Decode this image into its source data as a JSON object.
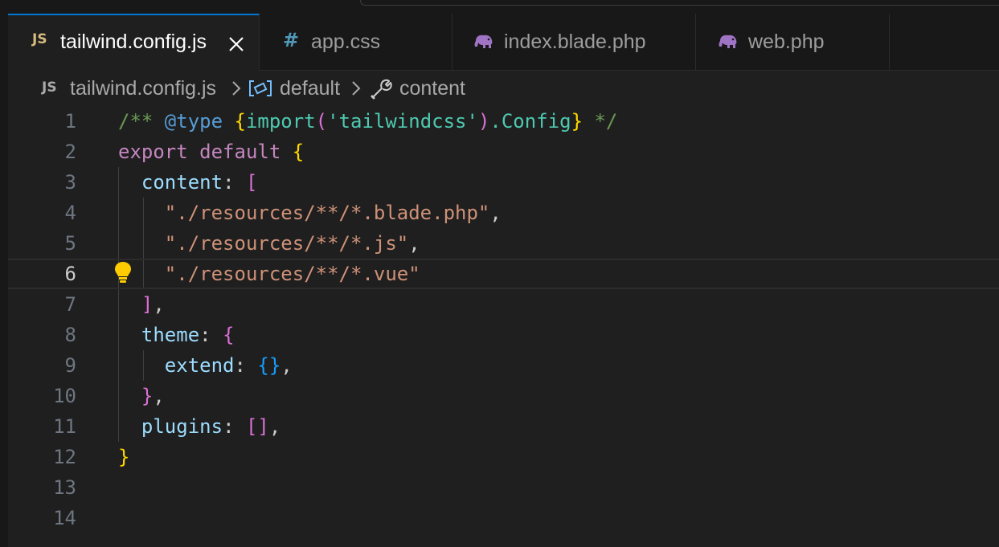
{
  "tabs": [
    {
      "icon": "JS",
      "icon_name": "javascript-icon",
      "label": "tailwind.config.js",
      "active": true
    },
    {
      "icon": "#",
      "icon_name": "css-hash-icon",
      "label": "app.css",
      "active": false
    },
    {
      "icon": "php",
      "icon_name": "php-elephant-icon",
      "label": "index.blade.php",
      "active": false
    },
    {
      "icon": "php",
      "icon_name": "php-elephant-icon",
      "label": "web.php",
      "active": false
    }
  ],
  "breadcrumb": {
    "file_icon": "JS",
    "file": "tailwind.config.js",
    "symbol1": "default",
    "symbol1_icon": "variable-symbol-icon",
    "symbol2": "content",
    "symbol2_icon": "wrench-property-icon"
  },
  "editor": {
    "current_line": 6,
    "lines": [
      {
        "n": "1",
        "tokens": [
          {
            "t": "/** ",
            "c": "tok-comment"
          },
          {
            "t": "@type",
            "c": "tok-doctag"
          },
          {
            "t": " ",
            "c": "tok-comment"
          },
          {
            "t": "{",
            "c": "b1"
          },
          {
            "t": "import",
            "c": "tok-type"
          },
          {
            "t": "(",
            "c": "b2"
          },
          {
            "t": "'tailwindcss'",
            "c": "tok-type"
          },
          {
            "t": ")",
            "c": "b2"
          },
          {
            "t": ".Config",
            "c": "tok-type"
          },
          {
            "t": "}",
            "c": "b1"
          },
          {
            "t": " */",
            "c": "tok-comment"
          }
        ]
      },
      {
        "n": "2",
        "tokens": [
          {
            "t": "export",
            "c": "tok-keyword"
          },
          {
            "t": " ",
            "c": "tok-punct"
          },
          {
            "t": "default",
            "c": "tok-keyword"
          },
          {
            "t": " ",
            "c": "tok-punct"
          },
          {
            "t": "{",
            "c": "b1"
          }
        ]
      },
      {
        "n": "3",
        "tokens": [
          {
            "t": "  ",
            "c": "tok-punct"
          },
          {
            "t": "content",
            "c": "tok-prop"
          },
          {
            "t": ": ",
            "c": "tok-punct"
          },
          {
            "t": "[",
            "c": "b2"
          }
        ]
      },
      {
        "n": "4",
        "tokens": [
          {
            "t": "    ",
            "c": "tok-punct"
          },
          {
            "t": "\"./resources/**/*.blade.php\"",
            "c": "tok-string"
          },
          {
            "t": ",",
            "c": "tok-punct"
          }
        ]
      },
      {
        "n": "5",
        "tokens": [
          {
            "t": "    ",
            "c": "tok-punct"
          },
          {
            "t": "\"./resources/**/*.js\"",
            "c": "tok-string"
          },
          {
            "t": ",",
            "c": "tok-punct"
          }
        ]
      },
      {
        "n": "6",
        "tokens": [
          {
            "t": "    ",
            "c": "tok-punct"
          },
          {
            "t": "\"./resources/**/*.vue\"",
            "c": "tok-string"
          }
        ]
      },
      {
        "n": "7",
        "tokens": [
          {
            "t": "  ",
            "c": "tok-punct"
          },
          {
            "t": "]",
            "c": "b2"
          },
          {
            "t": ",",
            "c": "tok-punct"
          }
        ]
      },
      {
        "n": "8",
        "tokens": [
          {
            "t": "  ",
            "c": "tok-punct"
          },
          {
            "t": "theme",
            "c": "tok-prop"
          },
          {
            "t": ": ",
            "c": "tok-punct"
          },
          {
            "t": "{",
            "c": "b2"
          }
        ]
      },
      {
        "n": "9",
        "tokens": [
          {
            "t": "    ",
            "c": "tok-punct"
          },
          {
            "t": "extend",
            "c": "tok-prop"
          },
          {
            "t": ": ",
            "c": "tok-punct"
          },
          {
            "t": "{}",
            "c": "b3"
          },
          {
            "t": ",",
            "c": "tok-punct"
          }
        ]
      },
      {
        "n": "10",
        "tokens": [
          {
            "t": "  ",
            "c": "tok-punct"
          },
          {
            "t": "}",
            "c": "b2"
          },
          {
            "t": ",",
            "c": "tok-punct"
          }
        ]
      },
      {
        "n": "11",
        "tokens": [
          {
            "t": "  ",
            "c": "tok-punct"
          },
          {
            "t": "plugins",
            "c": "tok-prop"
          },
          {
            "t": ": ",
            "c": "tok-punct"
          },
          {
            "t": "[]",
            "c": "b2"
          },
          {
            "t": ",",
            "c": "tok-punct"
          }
        ]
      },
      {
        "n": "12",
        "tokens": [
          {
            "t": "}",
            "c": "b1"
          }
        ]
      },
      {
        "n": "13",
        "tokens": []
      },
      {
        "n": "14",
        "tokens": []
      }
    ]
  },
  "lightbulb_icon": "lightbulb-icon",
  "colors": {
    "accent": "#0078d4",
    "editor_bg": "#1f1f1f",
    "tab_bg": "#181818",
    "js_icon": "#d7ba7d",
    "css_icon": "#519aba",
    "php_icon": "#a074c4",
    "lightbulb": "#ffcc00"
  }
}
